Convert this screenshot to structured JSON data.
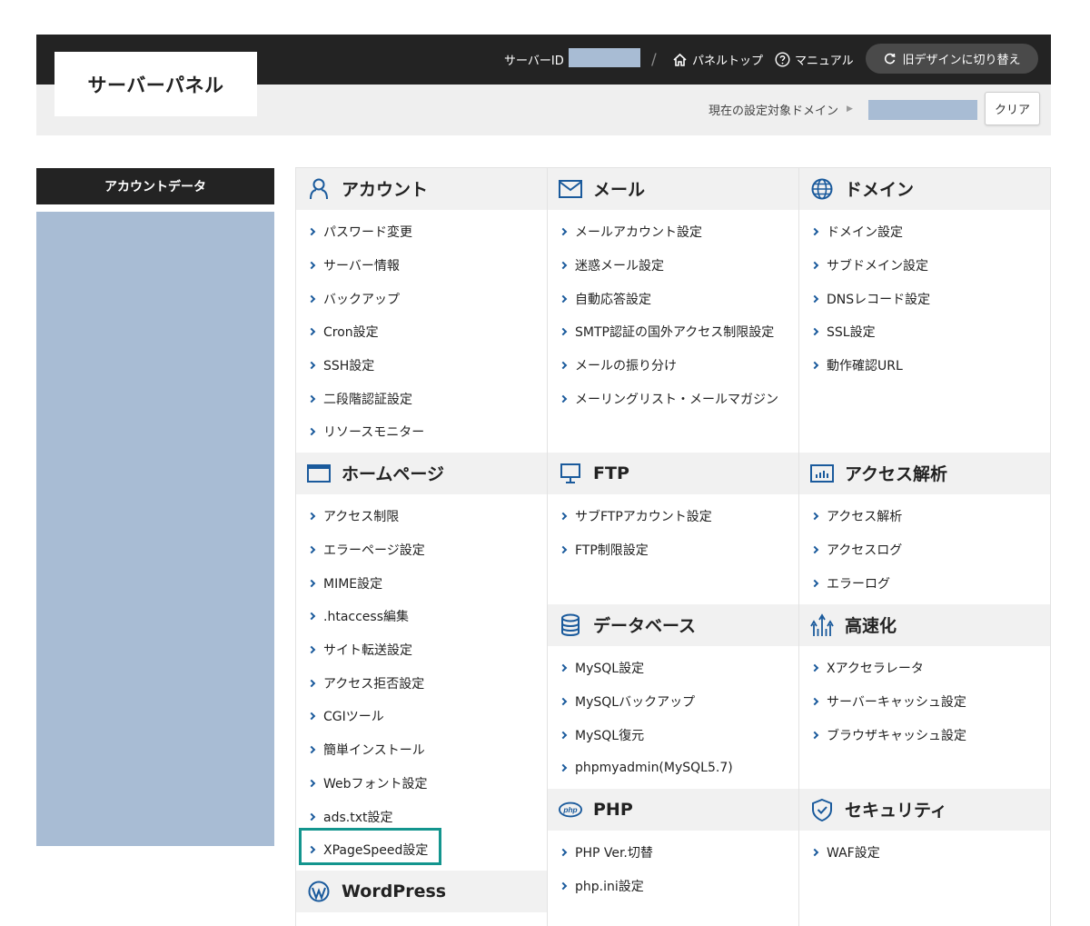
{
  "header": {
    "logo": "サーバーパネル",
    "server_id_label": "サーバーID",
    "slash": "/",
    "panel_top": "パネルトップ",
    "manual": "マニュアル",
    "old_design": "旧デザインに切り替え",
    "domain_label": "現在の設定対象ドメイン",
    "clear": "クリア"
  },
  "sidebar": {
    "title": "アカウントデータ"
  },
  "sections": {
    "account": {
      "title": "アカウント",
      "items": [
        "パスワード変更",
        "サーバー情報",
        "バックアップ",
        "Cron設定",
        "SSH設定",
        "二段階認証設定",
        "リソースモニター"
      ]
    },
    "mail": {
      "title": "メール",
      "items": [
        "メールアカウント設定",
        "迷惑メール設定",
        "自動応答設定",
        "SMTP認証の国外アクセス制限設定",
        "メールの振り分け",
        "メーリングリスト・メールマガジン"
      ]
    },
    "domain": {
      "title": "ドメイン",
      "items": [
        "ドメイン設定",
        "サブドメイン設定",
        "DNSレコード設定",
        "SSL設定",
        "動作確認URL"
      ]
    },
    "homepage": {
      "title": "ホームページ",
      "items": [
        "アクセス制限",
        "エラーページ設定",
        "MIME設定",
        ".htaccess編集",
        "サイト転送設定",
        "アクセス拒否設定",
        "CGIツール",
        "簡単インストール",
        "Webフォント設定",
        "ads.txt設定",
        "XPageSpeed設定"
      ]
    },
    "ftp": {
      "title": "FTP",
      "items": [
        "サブFTPアカウント設定",
        "FTP制限設定"
      ]
    },
    "access": {
      "title": "アクセス解析",
      "items": [
        "アクセス解析",
        "アクセスログ",
        "エラーログ"
      ]
    },
    "database": {
      "title": "データベース",
      "items": [
        "MySQL設定",
        "MySQLバックアップ",
        "MySQL復元",
        "phpmyadmin(MySQL5.7)"
      ]
    },
    "speed": {
      "title": "高速化",
      "items": [
        "Xアクセラレータ",
        "サーバーキャッシュ設定",
        "ブラウザキャッシュ設定"
      ]
    },
    "php": {
      "title": "PHP",
      "icon_text": "php",
      "items": [
        "PHP Ver.切替",
        "php.ini設定"
      ]
    },
    "security": {
      "title": "セキュリティ",
      "items": [
        "WAF設定"
      ]
    },
    "wordpress": {
      "title": "WordPress",
      "items": []
    }
  },
  "colors": {
    "accent": "#1a5a9c",
    "highlight": "#13958e",
    "masked": "#a8bcd4",
    "topbar": "#232323"
  },
  "icons": {
    "account": "person-icon",
    "mail": "envelope-icon",
    "domain": "globe-icon",
    "homepage": "browser-window-icon",
    "ftp": "monitor-icon",
    "access": "bar-chart-icon",
    "database": "database-icon",
    "speed": "speed-arrows-icon",
    "php": "php-icon",
    "security": "shield-check-icon",
    "wordpress": "wordpress-icon"
  }
}
